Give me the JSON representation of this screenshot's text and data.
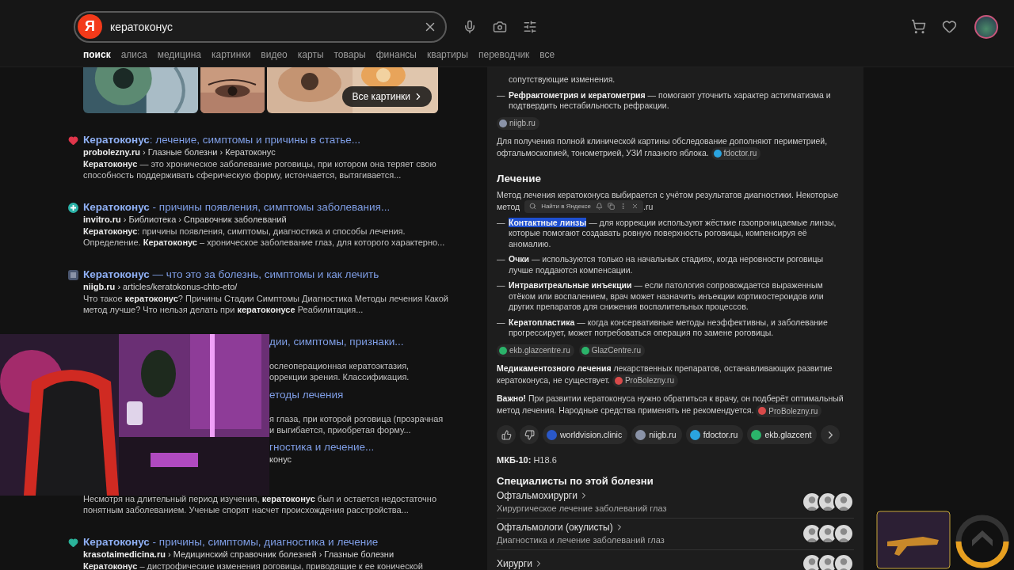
{
  "header": {
    "logo": "Я",
    "query": "кератоконус",
    "tabs": [
      {
        "label": "поиск",
        "selected": true
      },
      {
        "label": "алиса",
        "selected": false
      },
      {
        "label": "медицина",
        "selected": false
      },
      {
        "label": "картинки",
        "selected": false
      },
      {
        "label": "видео",
        "selected": false
      },
      {
        "label": "карты",
        "selected": false
      },
      {
        "label": "товары",
        "selected": false
      },
      {
        "label": "финансы",
        "selected": false
      },
      {
        "label": "квартиры",
        "selected": false
      },
      {
        "label": "переводчик",
        "selected": false
      },
      {
        "label": "все",
        "selected": false
      }
    ]
  },
  "images": {
    "button": "Все картинки"
  },
  "results": [
    {
      "kind": "heart",
      "color": "#e0364b",
      "title": "**Кератоконус**: лечение, симптомы и причины в статье...",
      "url": "**probolezny.ru** › Глазные болезни › Кератоконус",
      "snippet": [
        "**Кератоконус** — это хроническое заболевание роговицы, при котором она теряет свою",
        "способность поддерживать сферическую форму, истончается, вытягивается..."
      ]
    },
    {
      "kind": "plus",
      "color": "#2bb3a8",
      "title": "**Кератоконус** - причины появления, симптомы заболевания...",
      "url": "**invitro.ru** › Библиотека › Справочник заболеваний",
      "snippet": [
        "**Кератоконус**: причины появления, симптомы, диагностика и способы лечения.",
        "Определение. **Кератоконус** – хроническое заболевание глаз, для которого характерно..."
      ]
    },
    {
      "kind": "grid",
      "color": "#4a5670",
      "title": "**Кератоконус** — что это за болезнь, симптомы и как лечить",
      "url": "**niigb.ru** › articles/keratokonus-chto-eto/",
      "snippet": [
        "Что такое **кератоконус**? Причины Стадии Симптомы Диагностика Методы лечения Какой",
        "метод лучше? Что нельзя делать при **кератоконусе** Реабилитация..."
      ]
    }
  ],
  "covered": [
    {
      "title": "дии, симптомы, признаки...",
      "snippet": [
        "ослеоперационная кератоэктазия,",
        "оррекции зрения. Классификация."
      ]
    },
    {
      "title": "етоды лечения",
      "snippet": [
        "я глаза, при которой роговица (прозрачная",
        "и выгибается, приобретая форму..."
      ]
    },
    {
      "title": "гностика и лечение...",
      "url": "конус"
    }
  ],
  "covered_continuation": [
    "Несмотря на длительный период изучения, **кератоконус** был и остается недостаточно",
    "понятным заболеванием. Ученые спорят насчет происхождения расстройства..."
  ],
  "results_after": [
    {
      "kind": "heart",
      "color": "#2bb39a",
      "title": "**Кератоконус** - причины, симптомы, диагностика и лечение",
      "url": "**krasotaimedicina.ru** › Медицинский справочник болезней › Глазные болезни",
      "snippet": [
        "**Кератоконус** – дистрофические изменения роговицы, приводящие к ее конической"
      ]
    }
  ],
  "panel": {
    "diagnostics": [
      {
        "text": "сопутствующие изменения."
      },
      {
        "marker": "—",
        "text": "**Рефрактометрия и кератометрия** — помогают уточнить характер астигматизма и подтвердить нестабильность рефракции."
      }
    ],
    "diagnostics_sources": [
      {
        "label": "niigb.ru",
        "color": "#8a93a8"
      }
    ],
    "exam_note": {
      "text": "Для получения полной клинической картины обследование дополняют периметрией, офтальмоскопией, тонометрией, УЗИ глазного яблока.",
      "source": {
        "label": "fdoctor.ru",
        "color": "#2aa4e0"
      }
    },
    "treatment_heading": "Лечение",
    "treatment_intro": "Метод лечения кератоконуса выбирается с учётом результатов диагностики. Некоторые",
    "treatment_intro_cut": {
      "start": "метод",
      "end": ".ru"
    },
    "popup": {
      "label": "Найти в Яндексе"
    },
    "treatments": [
      {
        "marker": "—",
        "term": "Контактные линзы",
        "highlighted": true,
        "text": " — для коррекции используют жёсткие газопроницаемые линзы, которые помогают создавать ровную поверхность роговицы, компенсируя её аномалию."
      },
      {
        "marker": "—",
        "term": "Очки",
        "highlighted": false,
        "text": " — используются только на начальных стадиях, когда неровности роговицы лучше поддаются компенсации."
      },
      {
        "marker": "—",
        "term": "Интравитреальные инъекции",
        "highlighted": false,
        "text": " — если патология сопровождается выраженным отёком или воспалением, врач может назначить инъекции кортикостероидов или других препаратов для снижения воспалительных процессов."
      },
      {
        "marker": "—",
        "term": "Кератопластика",
        "highlighted": false,
        "text": " — когда консервативные методы неэффективны, и заболевание прогрессирует, может потребоваться операция по замене роговицы."
      }
    ],
    "treatment_sources": [
      {
        "label": "ekb.glazcentre.ru",
        "color": "#2bb36a"
      },
      {
        "label": "GlazCentre.ru",
        "color": "#2bb36a"
      }
    ],
    "drug_note": {
      "text": "**Медикаментозного лечения** лекарственных препаратов, останавливающих развитие кератоконуса, не существует.",
      "source": {
        "label": "ProBolezny.ru",
        "color": "#d84a4a"
      }
    },
    "warning": {
      "text": "**Важно!** При развитии кератоконуса нужно обратиться к врачу, он подберёт оптимальный метод лечения. Народные средства применять не рекомендуется.",
      "source": {
        "label": "ProBolezny.ru",
        "color": "#d84a4a"
      }
    },
    "feedback_sources": [
      {
        "label": "worldvision.clinic",
        "color": "#2a58c8"
      },
      {
        "label": "niigb.ru",
        "color": "#8a93a8"
      },
      {
        "label": "fdoctor.ru",
        "color": "#2aa4e0"
      },
      {
        "label": "ekb.glazcent",
        "color": "#2bb36a"
      }
    ],
    "icd": "**МКБ-10:** H18.6",
    "specialists": {
      "title": "Специалисты по этой болезни",
      "rows": [
        {
          "name": "Офтальмохирурги",
          "description": "Хирургическое лечение заболеваний глаз"
        },
        {
          "name": "Офтальмологи (окулисты)",
          "description": "Диагностика и лечение заболеваний глаз"
        },
        {
          "name": "Хирурги"
        }
      ]
    }
  }
}
